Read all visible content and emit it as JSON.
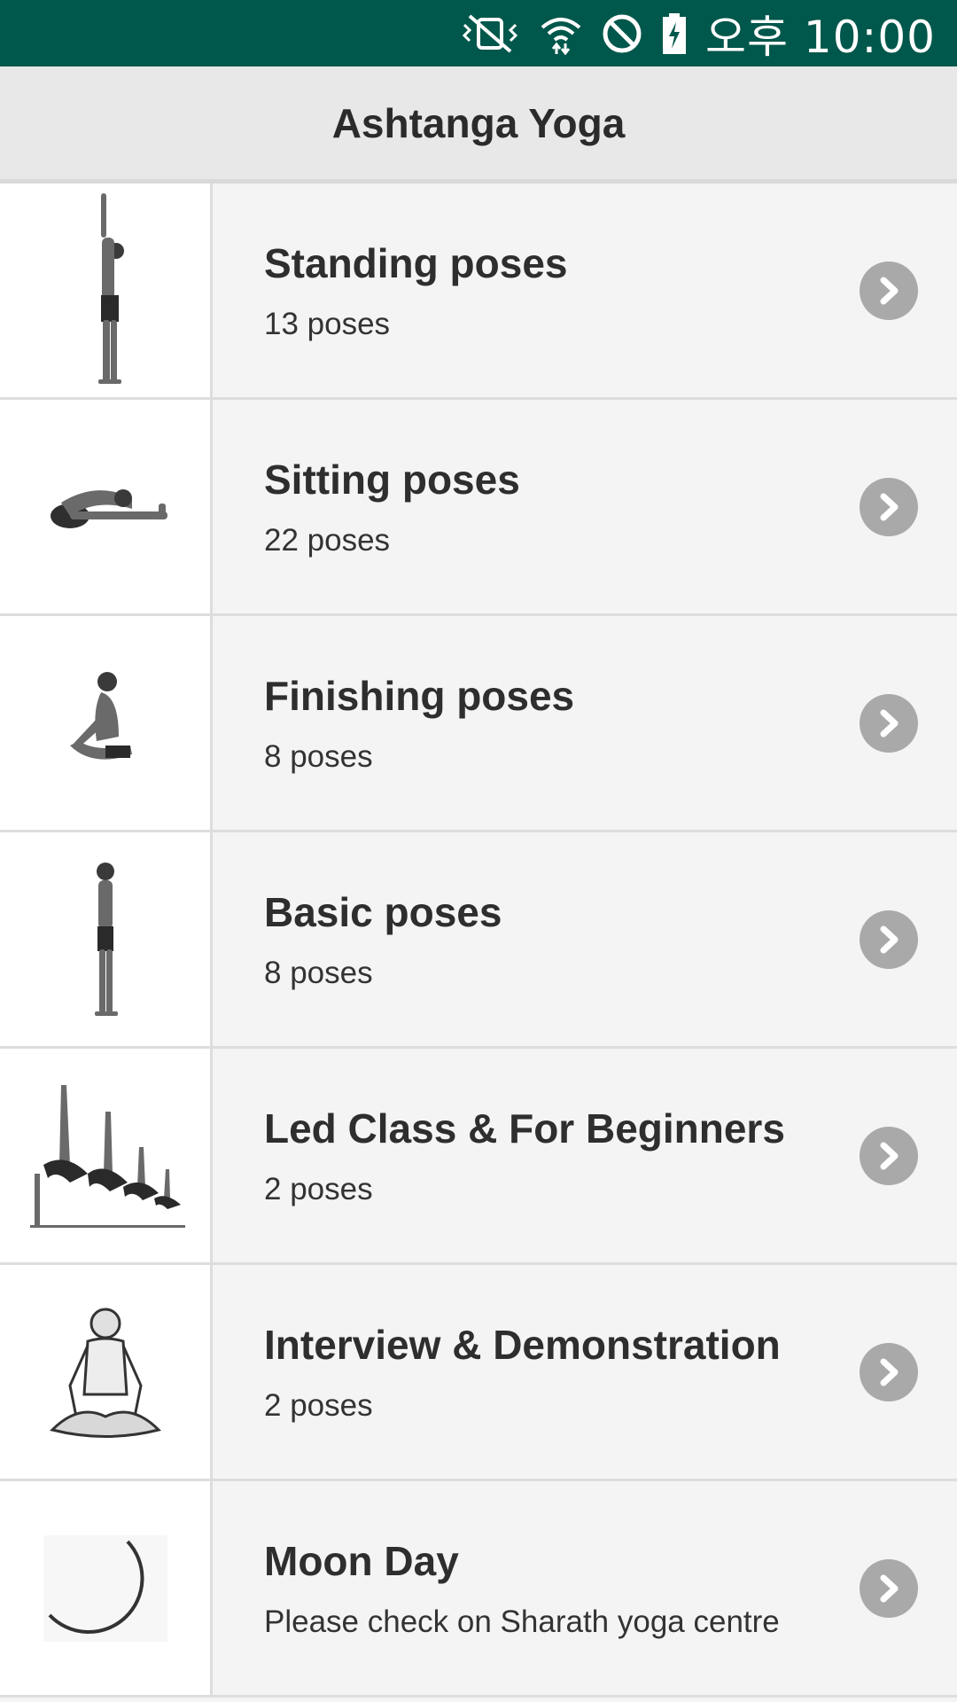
{
  "status_bar": {
    "time": "오후 10:00",
    "icons": [
      "vibrate-mute-icon",
      "wifi-icon",
      "do-not-disturb-icon",
      "battery-charging-icon"
    ]
  },
  "app": {
    "title": "Ashtanga Yoga"
  },
  "items": [
    {
      "title": "Standing poses",
      "subtitle": "13 poses",
      "thumbnail": "standing-pose-image"
    },
    {
      "title": "Sitting poses",
      "subtitle": "22 poses",
      "thumbnail": "sitting-pose-image"
    },
    {
      "title": "Finishing poses",
      "subtitle": "8 poses",
      "thumbnail": "finishing-pose-image"
    },
    {
      "title": "Basic poses",
      "subtitle": "8 poses",
      "thumbnail": "basic-pose-image"
    },
    {
      "title": "Led Class & For Beginners",
      "subtitle": "2 poses",
      "thumbnail": "led-class-image"
    },
    {
      "title": "Interview & Demonstration",
      "subtitle": "2 poses",
      "thumbnail": "interview-image"
    },
    {
      "title": "Moon Day",
      "subtitle": "Please check on Sharath yoga centre",
      "thumbnail": "moon-image"
    }
  ],
  "colors": {
    "status_bar": "#00574b",
    "title_bar": "#e8e8e8",
    "chevron": "#a9a9a9"
  }
}
